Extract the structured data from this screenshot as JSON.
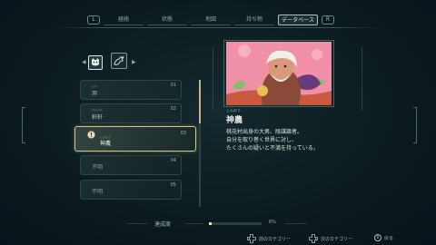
{
  "tabs": {
    "left_bumper": "L",
    "right_bumper": "R",
    "items": [
      {
        "label": "経絡"
      },
      {
        "label": "状態"
      },
      {
        "label": "地図"
      },
      {
        "label": "持ち物"
      },
      {
        "label": "データベース"
      }
    ],
    "active_index": 4
  },
  "categories": {
    "left_arrow": "◀",
    "right_arrow": "▶",
    "icons": [
      "cat-face-icon",
      "dragon-icon"
    ]
  },
  "list": {
    "entries": [
      {
        "num": "01",
        "ruby": "ふい",
        "name": "羿",
        "state": "normal"
      },
      {
        "num": "02",
        "ruby": "けんけん",
        "name": "軒軒",
        "state": "normal"
      },
      {
        "num": "03",
        "ruby": "しんのう",
        "name": "神農",
        "state": "selected"
      },
      {
        "num": "04",
        "ruby": "",
        "name": "不明",
        "state": "locked"
      },
      {
        "num": "05",
        "ruby": "",
        "name": "不明",
        "state": "locked"
      }
    ]
  },
  "detail": {
    "ruby": "しんのう",
    "name": "神農",
    "lines": [
      "桃花村出身の大男、陰謀論者。",
      "自分を取り巻く世界に対し、",
      "たくさんの疑いと不満を持っている。"
    ]
  },
  "progress": {
    "label": "達成度",
    "value_text": "6%",
    "fraction": 0.06
  },
  "footer": {
    "prev_label": "前のカテゴリー",
    "next_label": "次のカテゴリー",
    "back_label": "戻る",
    "back_button_glyph": "B"
  },
  "colors": {
    "accent_gold": "#d6c589",
    "portrait_bg": "#e98aa4"
  }
}
